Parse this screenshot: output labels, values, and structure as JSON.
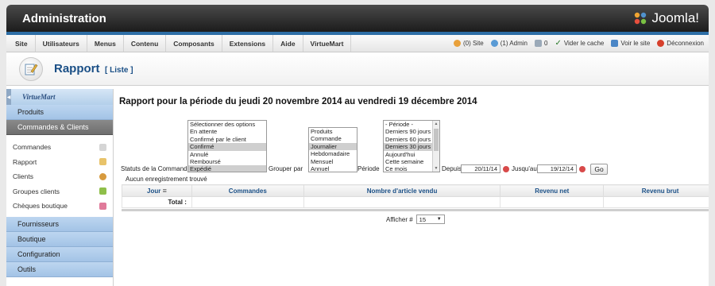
{
  "header": {
    "title": "Administration",
    "brand": "Joomla!"
  },
  "menu": {
    "items": [
      "Site",
      "Utilisateurs",
      "Menus",
      "Contenu",
      "Composants",
      "Extensions",
      "Aide",
      "VirtueMart"
    ],
    "status": {
      "site_users": "(0) Site",
      "admin_users": "(1) Admin",
      "messages": "0",
      "clear_cache": "Vider le cache",
      "view_site": "Voir le site",
      "logout": "Déconnexion"
    }
  },
  "toolbar": {
    "title": "Rapport",
    "subtitle": "[ Liste ]"
  },
  "sidebar": {
    "logo": "VirtueMart",
    "sections_top": [
      "Produits",
      "Commandes & Clients"
    ],
    "items": [
      "Commandes",
      "Rapport",
      "Clients",
      "Groupes clients",
      "Chèques boutique"
    ],
    "sections_bottom": [
      "Fournisseurs",
      "Boutique",
      "Configuration",
      "Outils"
    ]
  },
  "report": {
    "heading": "Rapport pour la période du jeudi 20 novembre 2014 au vendredi 19 décembre 2014",
    "status_label": "Statuts de la Commande",
    "status_options": [
      "Sélectionner des options",
      "En attente",
      "Confirmé par le client",
      "Confirmé",
      "Annulé",
      "Remboursé",
      "Expédié"
    ],
    "group_label": "Grouper par",
    "group_options": [
      "Produits",
      "Commande",
      "Journalier",
      "Hebdomadaire",
      "Mensuel",
      "Annuel"
    ],
    "period_label": "Période",
    "period_options": [
      "- Période -",
      "Derniers 90 jours",
      "Derniers 60 jours",
      "Derniers 30 jours",
      "Aujourd'hui",
      "Cette semaine",
      "Ce mois"
    ],
    "from_label": "Depuis",
    "from_date": "20/11/14",
    "to_label": "Jusqu'au",
    "to_date": "19/12/14",
    "go": "Go",
    "no_records": "Aucun enregistrement trouvé",
    "columns": [
      "Jour",
      "Commandes",
      "Nombre d'article vendu",
      "Revenu net",
      "Revenu brut"
    ],
    "total_label": "Total :",
    "display_label": "Afficher #",
    "display_value": "15"
  }
}
